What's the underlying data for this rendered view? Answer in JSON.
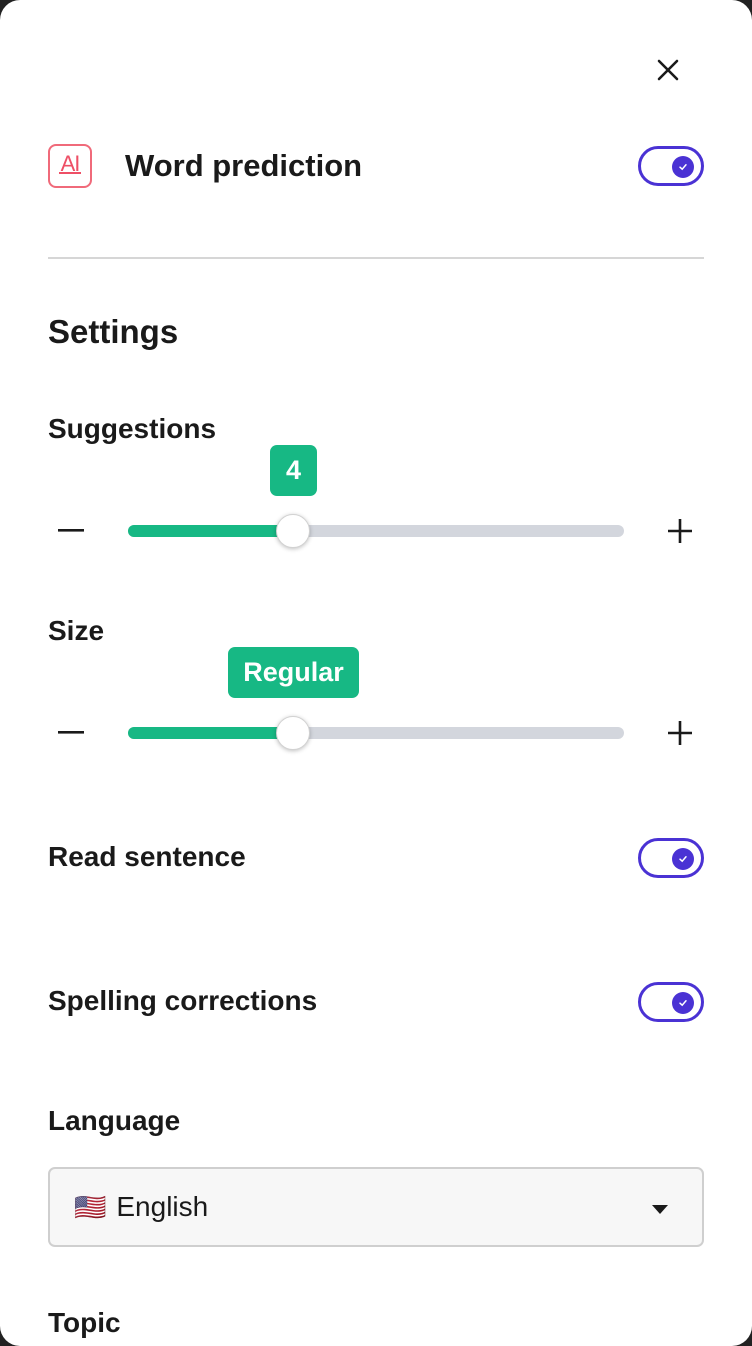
{
  "header": {
    "icon": "ai-text-icon",
    "icon_text": "AI",
    "title": "Word prediction",
    "toggle_on": true
  },
  "settings": {
    "title": "Settings",
    "suggestions": {
      "label": "Suggestions",
      "value": "4",
      "fraction": 0.333,
      "minus": "−",
      "plus": "+"
    },
    "size": {
      "label": "Size",
      "value": "Regular",
      "fraction": 0.333,
      "minus": "−",
      "plus": "+"
    },
    "read_sentence": {
      "label": "Read sentence",
      "toggle_on": true
    },
    "spelling_corrections": {
      "label": "Spelling corrections",
      "toggle_on": true
    },
    "language": {
      "label": "Language",
      "flag": "🇺🇸",
      "value": "English"
    },
    "topic": {
      "label": "Topic"
    }
  },
  "colors": {
    "accent": "#4a32d4",
    "slider_fill": "#17b884",
    "track": "#d3d6dd",
    "ai_icon": "#ee4f66"
  }
}
